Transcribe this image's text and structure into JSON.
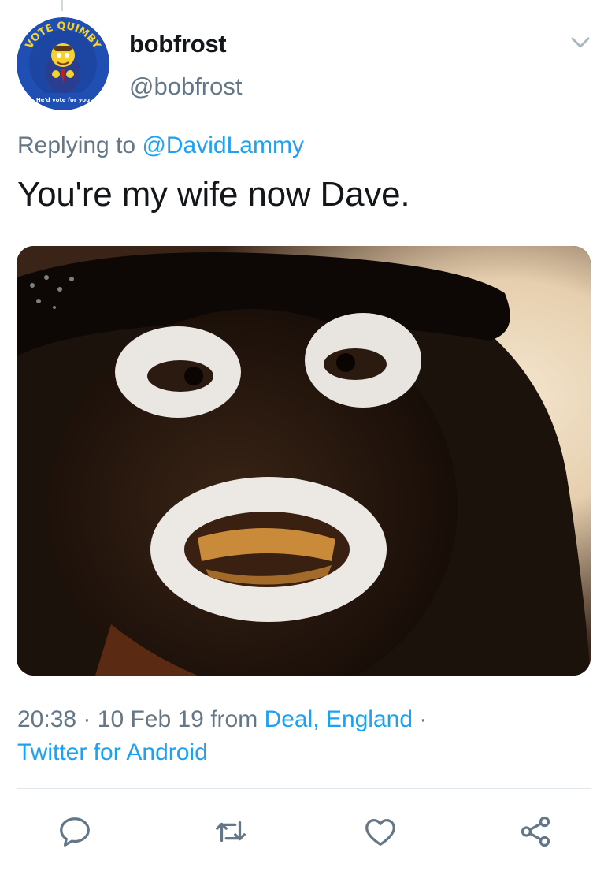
{
  "author": {
    "display_name": "bobfrost",
    "handle": "@bobfrost",
    "avatar_text_top": "VOTE QUIMBY",
    "avatar_text_bottom": "He'd vote for you"
  },
  "reply": {
    "prefix": "Replying to ",
    "mention": "@DavidLammy"
  },
  "tweet": {
    "text": "You're my wife now Dave."
  },
  "meta": {
    "time": "20:38",
    "date": "10 Feb 19",
    "from_word": "from",
    "location": "Deal, England",
    "client": "Twitter for Android"
  },
  "icons": {
    "menu": "chevron-down-icon",
    "reply": "reply-icon",
    "retweet": "retweet-icon",
    "like": "heart-icon",
    "share": "share-icon"
  },
  "colors": {
    "link": "#1da1f2",
    "secondary_text": "#657786",
    "primary_text": "#14171a",
    "icon": "#657786"
  }
}
